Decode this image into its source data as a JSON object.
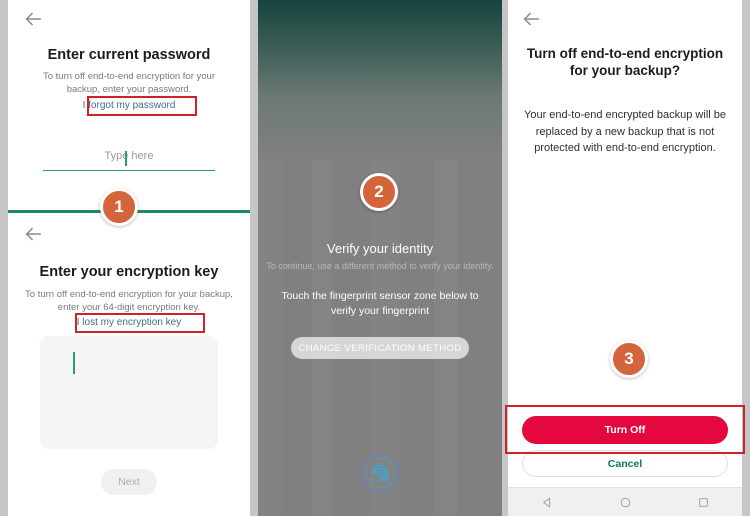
{
  "screens": {
    "step1": {
      "back_icon": "arrow-left-icon",
      "title": "Enter current password",
      "subtitle": "To turn off end-to-end encryption for your backup, enter your password.",
      "link": "I forgot my password",
      "input_placeholder": "Type here"
    },
    "step1b": {
      "back_icon": "arrow-left-icon",
      "title": "Enter your encryption key",
      "subtitle": "To turn off end-to-end encryption for your backup, enter your 64-digit encryption key.",
      "link": "I lost my encryption key",
      "textarea_value": "",
      "next_label": "Next"
    },
    "step2": {
      "title": "Verify your identity",
      "subtitle": "To continue, use a different method to verify your identity.",
      "instruction": "Touch the fingerprint sensor zone below to verify your fingerprint",
      "change_method_label": "CHANGE VERIFICATION METHOD",
      "fingerprint_icon": "fingerprint-icon"
    },
    "step3": {
      "back_icon": "arrow-left-icon",
      "title": "Turn off end-to-end encryption for your backup?",
      "body": "Your end-to-end encrypted backup will be replaced by a new backup that is not protected with end-to-end encryption.",
      "turn_off_label": "Turn Off",
      "cancel_label": "Cancel"
    }
  },
  "navbar": {
    "back_icon": "triangle-back-icon",
    "home_icon": "circle-home-icon",
    "recents_icon": "square-recents-icon"
  },
  "badges": {
    "one": "1",
    "two": "2",
    "three": "3"
  },
  "colors": {
    "badge": "#d4643c",
    "highlight_box": "#cf2128",
    "turn_off_button": "#e4083f",
    "cancel_text": "#0c7a5c",
    "link": "#3f6f8e",
    "input_underline": "#2e9b6e",
    "divider": "#1f8a62",
    "overlay_gradient_top": "#16443e",
    "overlay_gradient_bottom": "#808080"
  }
}
